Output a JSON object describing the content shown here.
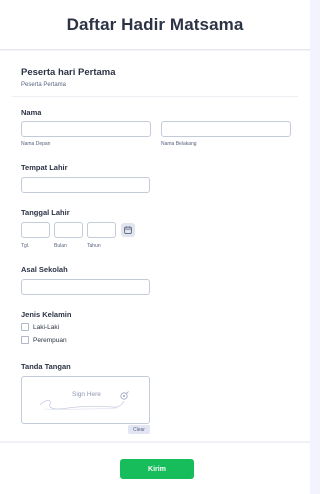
{
  "form": {
    "title": "Daftar Hadir Matsama"
  },
  "section": {
    "title": "Peserta hari Pertama",
    "subtitle": "Peserta Pertama"
  },
  "fields": {
    "nama": {
      "label": "Nama",
      "first_sublabel": "Nama Depan",
      "last_sublabel": "Nama Belakang",
      "first_value": "",
      "last_value": ""
    },
    "tempat_lahir": {
      "label": "Tempat Lahir",
      "value": ""
    },
    "tanggal_lahir": {
      "label": "Tanggal Lahir",
      "day_sublabel": "Tgl.",
      "month_sublabel": "Bulan",
      "year_sublabel": "Tahun",
      "calendar_icon": "calendar-icon"
    },
    "asal_sekolah": {
      "label": "Asal Sekolah",
      "value": ""
    },
    "jenis_kelamin": {
      "label": "Jenis Kelamin",
      "options": [
        "Laki-Laki",
        "Perempuan"
      ]
    },
    "tanda_tangan": {
      "label": "Tanda Tangan",
      "placeholder": "Sign Here",
      "clear_label": "Clear",
      "pen_icon": "pen-icon"
    }
  },
  "submit": {
    "label": "Kirim",
    "color": "#18bd5b"
  },
  "colors": {
    "background": "#f3f3fe",
    "text": "#2c3345",
    "border": "#c3cad8"
  }
}
